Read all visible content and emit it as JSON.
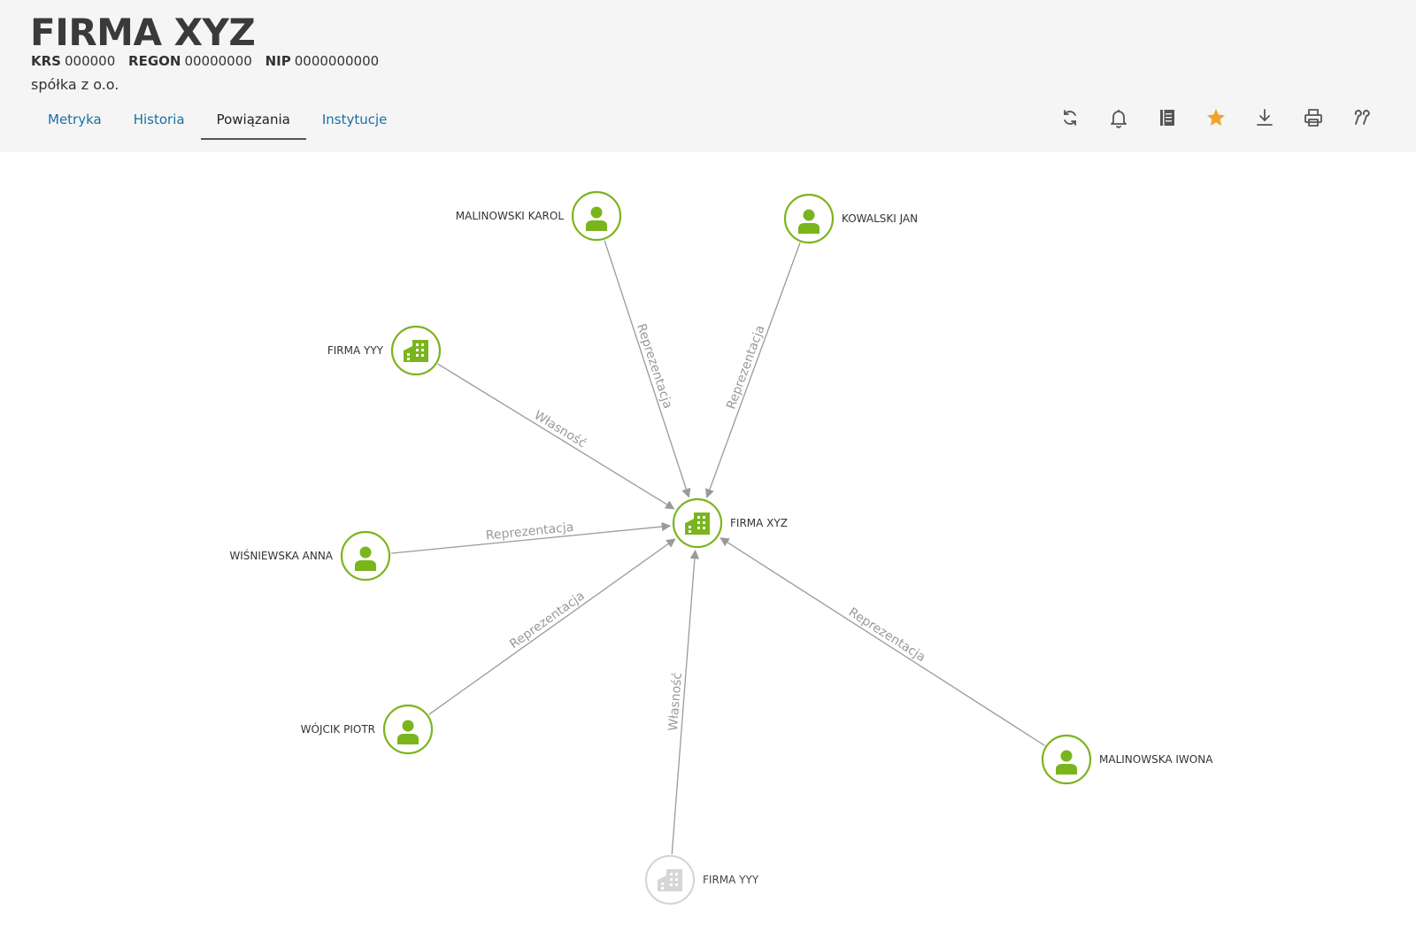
{
  "header": {
    "title": "FIRMA XYZ",
    "krs_label": "KRS",
    "krs_value": "000000",
    "regon_label": "REGON",
    "regon_value": "00000000",
    "nip_label": "NIP",
    "nip_value": "0000000000",
    "legal_form": "spółka z o.o."
  },
  "tabs": [
    {
      "label": "Metryka",
      "active": false
    },
    {
      "label": "Historia",
      "active": false
    },
    {
      "label": "Powiązania",
      "active": true
    },
    {
      "label": "Instytucje",
      "active": false
    }
  ],
  "toolbar": [
    "refresh-icon",
    "bell-icon",
    "notebook-icon",
    "star-icon",
    "download-icon",
    "print-icon",
    "quote-icon"
  ],
  "colors": {
    "accent_green": "#7ab51d",
    "star": "#f0a42b",
    "tab_link": "#1a6fa3",
    "edge": "#9a9a9a"
  },
  "graph": {
    "center": {
      "label": "FIRMA XYZ",
      "type": "company"
    },
    "nodes": [
      {
        "label": "MALINOWSKI KAROL",
        "type": "person"
      },
      {
        "label": "KOWALSKI JAN",
        "type": "person"
      },
      {
        "label": "FIRMA YYY",
        "type": "company"
      },
      {
        "label": "WIŚNIEWSKA ANNA",
        "type": "person"
      },
      {
        "label": "WÓJCIK PIOTR",
        "type": "person"
      },
      {
        "label": "FIRMA YYY",
        "type": "company",
        "faded": true
      },
      {
        "label": "MALINOWSKA IWONA",
        "type": "person"
      }
    ],
    "edges": [
      {
        "label": "Reprezentacja"
      },
      {
        "label": "Reprezentacja"
      },
      {
        "label": "Własność"
      },
      {
        "label": "Reprezentacja"
      },
      {
        "label": "Reprezentacja"
      },
      {
        "label": "Własność"
      },
      {
        "label": "Reprezentacja"
      }
    ]
  }
}
